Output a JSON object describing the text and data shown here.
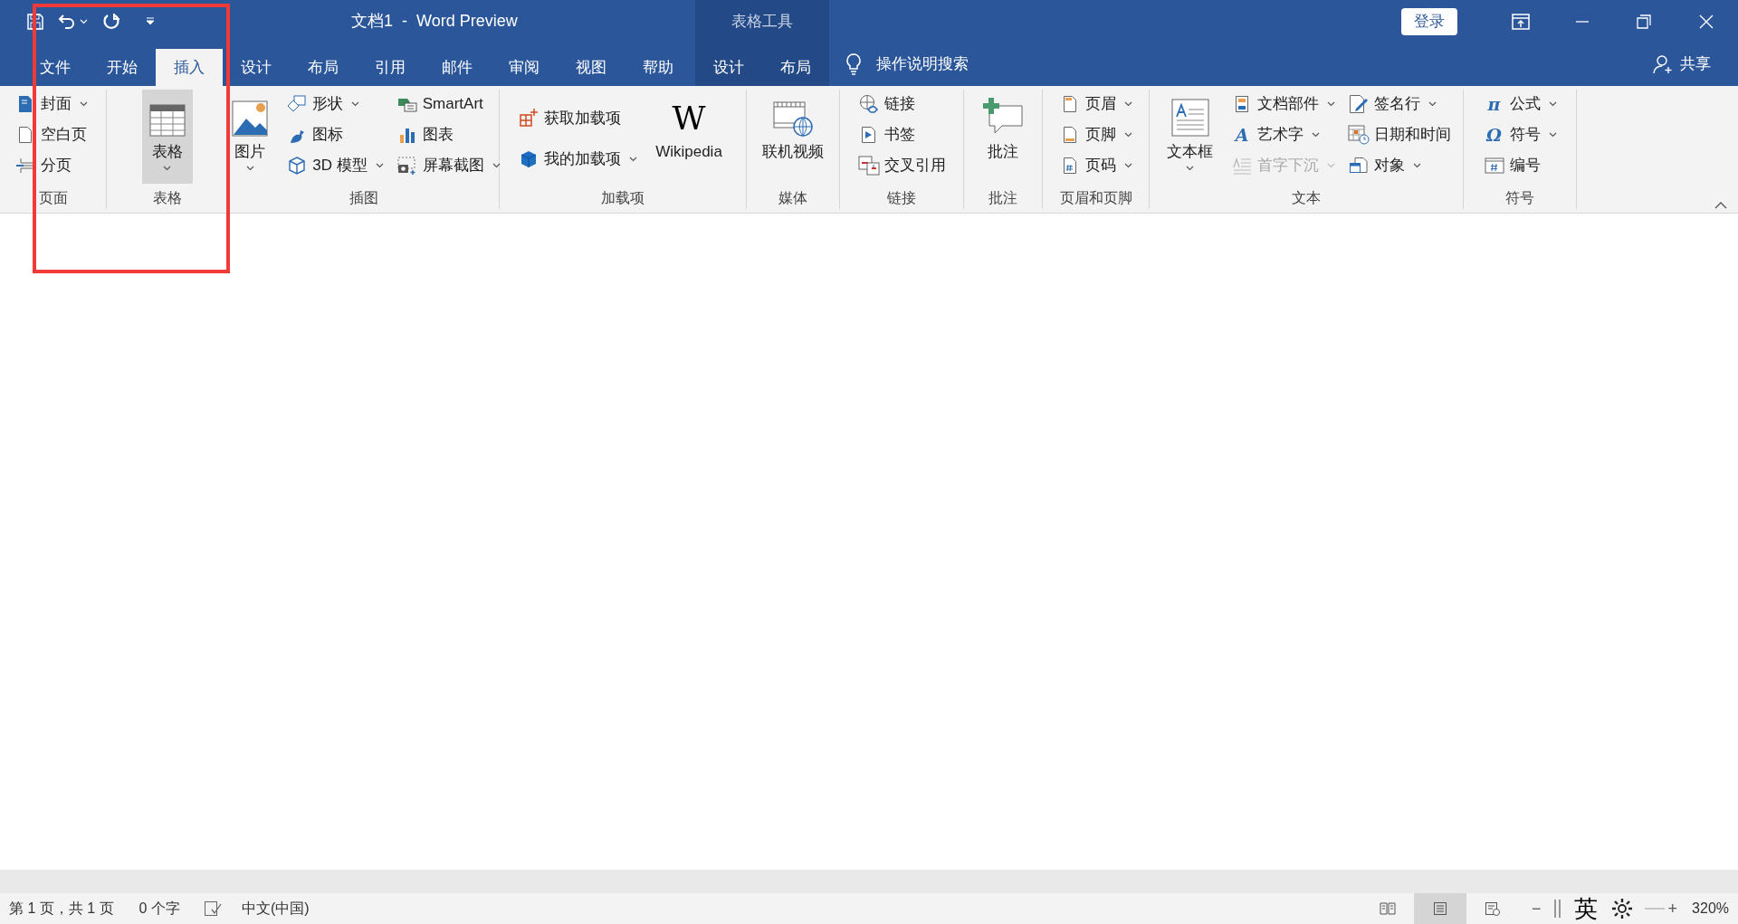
{
  "title_bar": {
    "title": "文档1  -  Word Preview",
    "context_label": "表格工具",
    "sign_in": "登录"
  },
  "tabs": [
    {
      "label": "文件",
      "selected": false,
      "kind": "main"
    },
    {
      "label": "开始",
      "selected": false,
      "kind": "main"
    },
    {
      "label": "插入",
      "selected": true,
      "kind": "main"
    },
    {
      "label": "设计",
      "selected": false,
      "kind": "main"
    },
    {
      "label": "布局",
      "selected": false,
      "kind": "main"
    },
    {
      "label": "引用",
      "selected": false,
      "kind": "main"
    },
    {
      "label": "邮件",
      "selected": false,
      "kind": "main"
    },
    {
      "label": "审阅",
      "selected": false,
      "kind": "main"
    },
    {
      "label": "视图",
      "selected": false,
      "kind": "main"
    },
    {
      "label": "帮助",
      "selected": false,
      "kind": "main"
    },
    {
      "label": "设计",
      "selected": false,
      "kind": "context"
    },
    {
      "label": "布局",
      "selected": false,
      "kind": "context"
    }
  ],
  "tell_me": "操作说明搜索",
  "share": "共享",
  "ribbon": {
    "groups": [
      {
        "label": "页面",
        "columns": [
          {
            "kind": "stack",
            "items": [
              {
                "label": "封面",
                "dropdown": true
              },
              {
                "label": "空白页",
                "dropdown": false
              },
              {
                "label": "分页",
                "dropdown": false
              }
            ]
          }
        ]
      },
      {
        "label": "表格",
        "columns": [
          {
            "kind": "large",
            "label": "表格",
            "dropdown": true,
            "highlighted": true
          }
        ]
      },
      {
        "label": "插图",
        "columns": [
          {
            "kind": "large",
            "label": "图片",
            "dropdown": true,
            "highlighted": false
          },
          {
            "kind": "stack",
            "items": [
              {
                "label": "形状",
                "dropdown": true
              },
              {
                "label": "图标",
                "dropdown": false
              },
              {
                "label": "3D 模型",
                "dropdown": true
              }
            ]
          },
          {
            "kind": "stack",
            "items": [
              {
                "label": "SmartArt",
                "dropdown": false
              },
              {
                "label": "图表",
                "dropdown": false
              },
              {
                "label": "屏幕截图",
                "dropdown": true
              }
            ]
          }
        ]
      },
      {
        "label": "加载项",
        "columns": [
          {
            "kind": "stack",
            "items": [
              {
                "label": "获取加载项",
                "dropdown": false
              },
              {
                "label": "我的加载项",
                "dropdown": true
              }
            ]
          },
          {
            "kind": "large",
            "label": "Wikipedia",
            "glyph": "W",
            "dropdown": false,
            "highlighted": false
          }
        ]
      },
      {
        "label": "媒体",
        "columns": [
          {
            "kind": "large",
            "label": "联机视频",
            "dropdown": false,
            "highlighted": false
          }
        ]
      },
      {
        "label": "链接",
        "columns": [
          {
            "kind": "stack",
            "items": [
              {
                "label": "链接",
                "dropdown": false
              },
              {
                "label": "书签",
                "dropdown": false
              },
              {
                "label": "交叉引用",
                "dropdown": false
              }
            ]
          }
        ]
      },
      {
        "label": "批注",
        "columns": [
          {
            "kind": "large",
            "label": "批注",
            "dropdown": false,
            "highlighted": false
          }
        ]
      },
      {
        "label": "页眉和页脚",
        "columns": [
          {
            "kind": "stack",
            "items": [
              {
                "label": "页眉",
                "dropdown": true
              },
              {
                "label": "页脚",
                "dropdown": true
              },
              {
                "label": "页码",
                "dropdown": true
              }
            ]
          }
        ]
      },
      {
        "label": "文本",
        "columns": [
          {
            "kind": "large",
            "label": "文本框",
            "dropdown": true,
            "highlighted": false
          },
          {
            "kind": "stack",
            "items": [
              {
                "label": "文档部件",
                "dropdown": true,
                "disabled": false
              },
              {
                "label": "艺术字",
                "glyph": "A",
                "dropdown": true,
                "disabled": false
              },
              {
                "label": "首字下沉",
                "dropdown": true,
                "disabled": true
              }
            ]
          },
          {
            "kind": "stack",
            "items": [
              {
                "label": "签名行",
                "dropdown": true,
                "disabled": false
              },
              {
                "label": "日期和时间",
                "dropdown": false,
                "disabled": false
              },
              {
                "label": "对象",
                "dropdown": true,
                "disabled": false
              }
            ]
          }
        ]
      },
      {
        "label": "符号",
        "columns": [
          {
            "kind": "stack",
            "items": [
              {
                "label": "公式",
                "glyph": "π",
                "dropdown": true
              },
              {
                "label": "符号",
                "glyph": "Ω",
                "dropdown": true
              },
              {
                "label": "编号",
                "dropdown": false
              }
            ]
          }
        ]
      }
    ]
  },
  "highlight_frame": true,
  "status_bar": {
    "page": "第 1 页，共 1 页",
    "words": "0 个字",
    "language": "中文(中国)",
    "views": [
      {
        "selected": false
      },
      {
        "selected": true
      },
      {
        "selected": false
      }
    ],
    "zoom_minus": "−",
    "ime": "英",
    "zoom_plus": "+",
    "zoom": "320%"
  }
}
